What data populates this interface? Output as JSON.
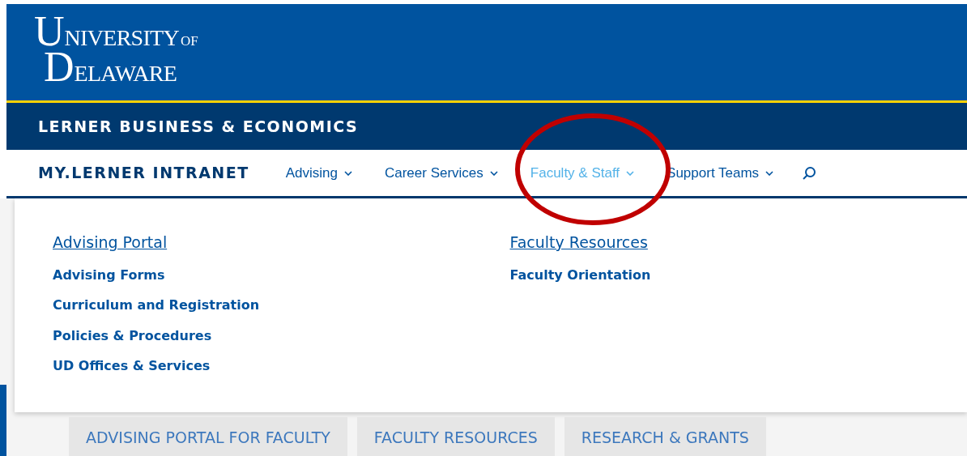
{
  "logo": {
    "initials": [
      "U",
      "D"
    ],
    "lines": [
      "NIVERSITY",
      "ELAWARE"
    ],
    "suffix": "OF"
  },
  "college_bar": {
    "title": "LERNER BUSINESS & ECONOMICS"
  },
  "nav": {
    "title": "MY.LERNER INTRANET",
    "items": [
      {
        "label": "Advising",
        "selected": false
      },
      {
        "label": "Career Services",
        "selected": false
      },
      {
        "label": "Faculty & Staff",
        "selected": true
      },
      {
        "label": "Support Teams",
        "selected": false
      }
    ]
  },
  "dropdown": {
    "columns": [
      {
        "heading": "Advising Portal",
        "links": [
          "Advising Forms",
          "Curriculum and Registration",
          "Policies & Procedures",
          "UD Offices & Services"
        ]
      },
      {
        "heading": "Faculty Resources",
        "links": [
          "Faculty Orientation"
        ]
      }
    ]
  },
  "tabs": [
    {
      "label": "ADVISING PORTAL FOR FACULTY"
    },
    {
      "label": "FACULTY RESOURCES"
    },
    {
      "label": "RESEARCH & GRANTS"
    }
  ]
}
